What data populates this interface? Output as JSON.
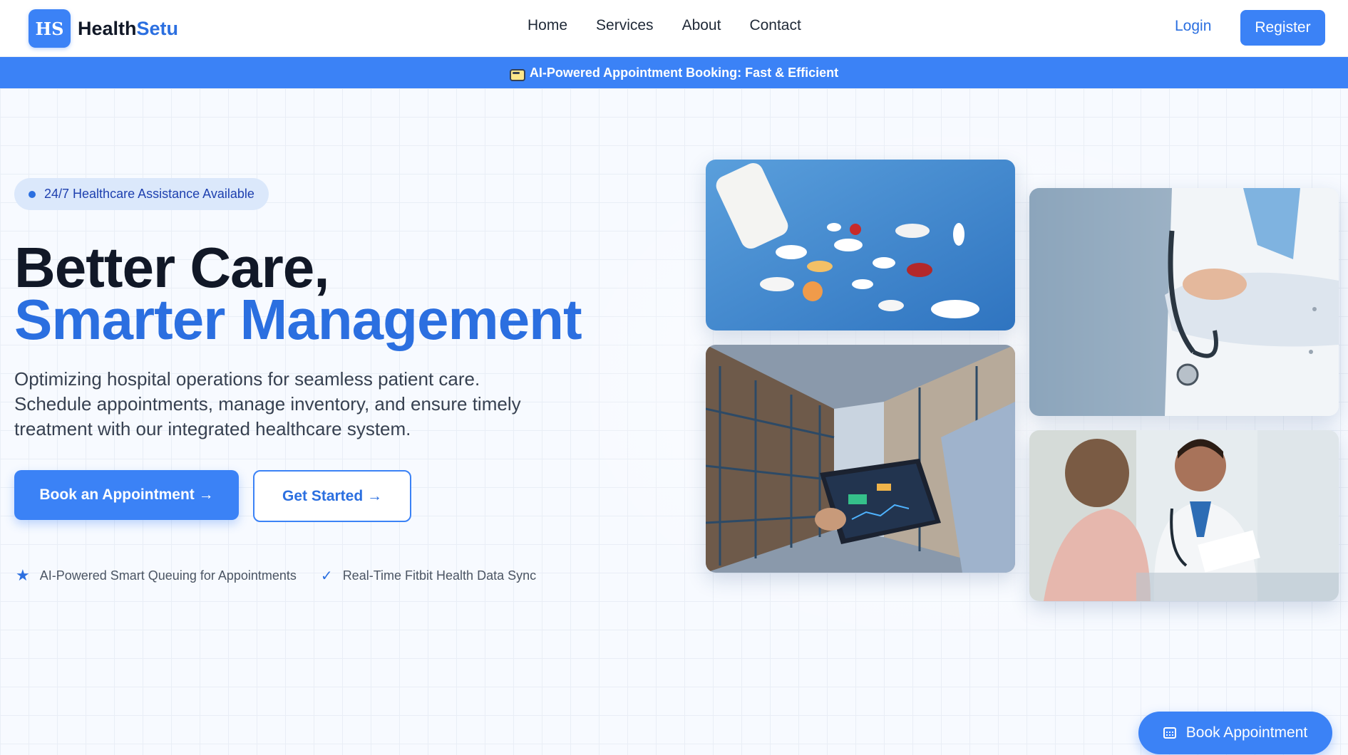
{
  "header": {
    "logo_badge": "HS",
    "logo_text_main": "Health",
    "logo_text_accent": "Setu",
    "nav": [
      {
        "label": "Home"
      },
      {
        "label": "Services"
      },
      {
        "label": "About"
      },
      {
        "label": "Contact"
      }
    ],
    "login_label": "Login",
    "register_label": "Register"
  },
  "banner": {
    "icon": "robot-icon",
    "text": "AI-Powered Appointment Booking: Fast & Efficient"
  },
  "hero": {
    "badge": "24/7 Healthcare Assistance Available",
    "headline_line1": "Better Care,",
    "headline_line2": "Smarter Management",
    "description": "Optimizing hospital operations for seamless patient care. Schedule appointments, manage inventory, and ensure timely treatment with our integrated healthcare system.",
    "primary_button": "Book an Appointment →",
    "secondary_button": "Get Started →",
    "features": [
      {
        "icon": "star-icon",
        "text": "AI-Powered Smart Queuing for Appointments"
      },
      {
        "icon": "check-icon",
        "text": "Real-Time Fitbit Health Data Sync"
      }
    ]
  },
  "images": [
    {
      "name": "pills-image"
    },
    {
      "name": "warehouse-tablet-image"
    },
    {
      "name": "doctor-stethoscope-image"
    },
    {
      "name": "doctor-patient-consultation-image"
    }
  ],
  "floating_button": {
    "icon": "calendar-icon",
    "label": "Book Appointment"
  },
  "colors": {
    "primary": "#3b82f6",
    "accent_text": "#2b6fe0",
    "heading": "#111827",
    "pill_bg": "#dbe8fb"
  }
}
